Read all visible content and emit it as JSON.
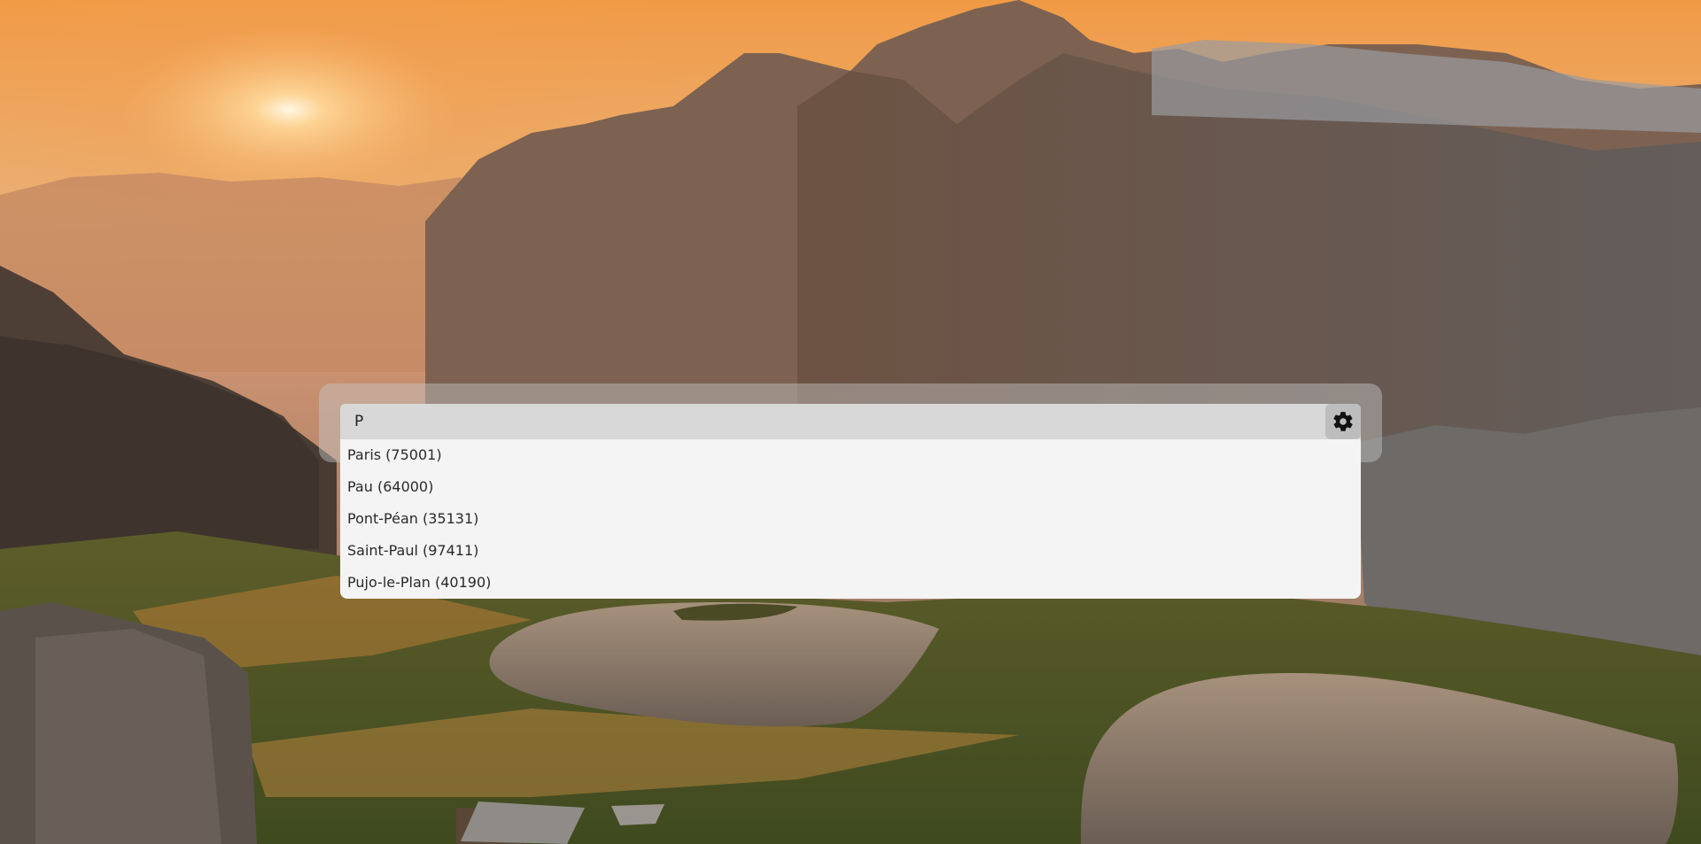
{
  "search": {
    "value": "P",
    "settings_icon": "gear-icon"
  },
  "suggestions": [
    "Paris (75001)",
    "Pau (64000)",
    "Pont-Péan (35131)",
    "Saint-Paul (97411)",
    "Pujo-le-Plan (40190)"
  ],
  "colors": {
    "sky_top": "#f1a14d",
    "sky_bottom": "#e8b27a",
    "panel": "#c8c8c8",
    "input_bg": "#d8d8d8",
    "dropdown_bg": "#f4f4f4"
  }
}
